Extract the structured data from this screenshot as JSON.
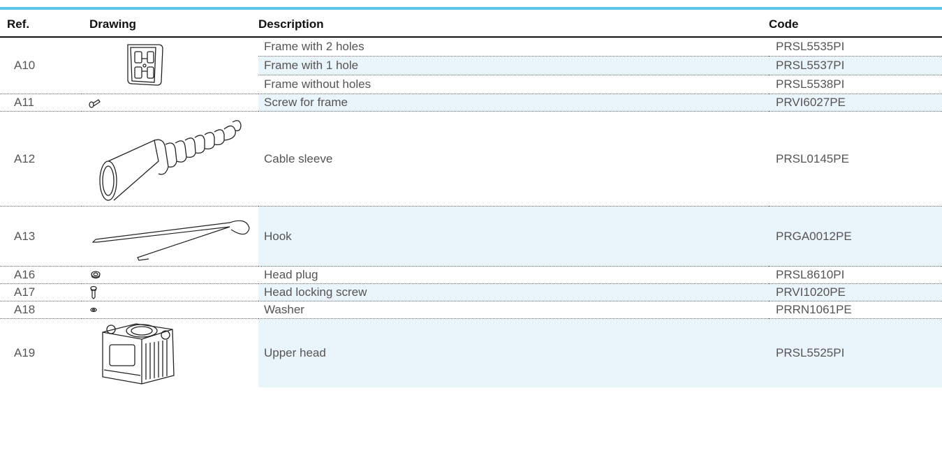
{
  "table": {
    "headers": {
      "ref": "Ref.",
      "drawing": "Drawing",
      "description": "Description",
      "code": "Code"
    },
    "rows": [
      {
        "ref": "A10",
        "drawing": "frame-icon",
        "description": "Frame with 2 holes",
        "code": "PRSL5535PI"
      },
      {
        "ref": "",
        "drawing": "",
        "description": "Frame with 1 hole",
        "code": "PRSL5537PI"
      },
      {
        "ref": "",
        "drawing": "",
        "description": "Frame without holes",
        "code": "PRSL5538PI"
      },
      {
        "ref": "A11",
        "drawing": "screw-icon",
        "description": "Screw for frame",
        "code": "PRVI6027PE"
      },
      {
        "ref": "A12",
        "drawing": "cable-sleeve-icon",
        "description": "Cable sleeve",
        "code": "PRSL0145PE"
      },
      {
        "ref": "A13",
        "drawing": "hook-icon",
        "description": "Hook",
        "code": "PRGA0012PE"
      },
      {
        "ref": "A16",
        "drawing": "head-plug-icon",
        "description": "Head plug",
        "code": "PRSL8610PI"
      },
      {
        "ref": "A17",
        "drawing": "locking-screw-icon",
        "description": "Head locking screw",
        "code": "PRVI1020PE"
      },
      {
        "ref": "A18",
        "drawing": "washer-icon",
        "description": "Washer",
        "code": "PRRN1061PE"
      },
      {
        "ref": "A19",
        "drawing": "upper-head-icon",
        "description": "Upper head",
        "code": "PRSL5525PI"
      }
    ]
  },
  "colors": {
    "accent": "#5bc6e8",
    "row_shade": "#eaf4fb"
  }
}
